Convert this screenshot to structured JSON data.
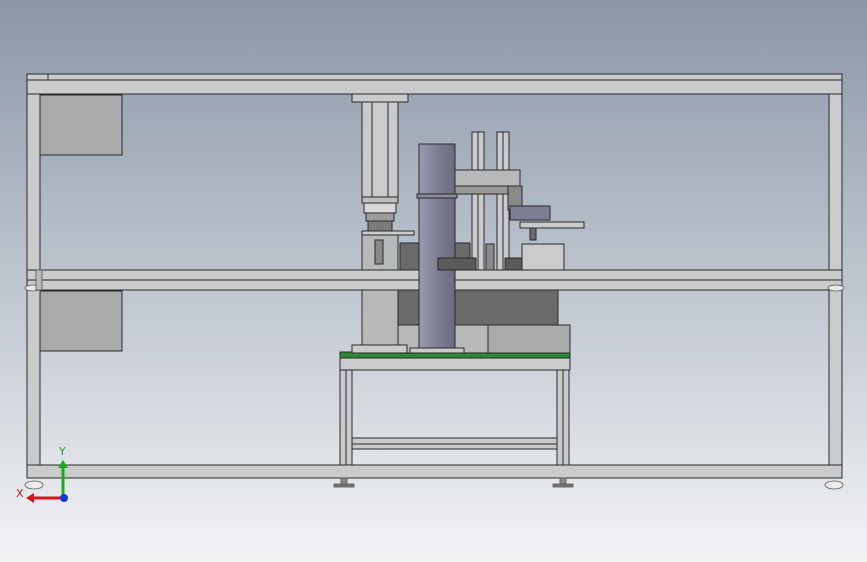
{
  "viewport": {
    "background_top": "#8a97a8",
    "background_bottom": "#f2f3f5"
  },
  "triad": {
    "x_label": "X",
    "y_label": "Y",
    "x_color": "#d0141b",
    "y_color": "#1fa81f",
    "z_color": "#1538d8"
  },
  "model": {
    "frame_color": "#c9cbcc",
    "edge_color": "#2a2a2a",
    "panel_color": "#a9aaab",
    "column_color": "#7e7f95",
    "dark_part_color": "#5a5a5a",
    "plate_color": "#2a8a3a"
  }
}
